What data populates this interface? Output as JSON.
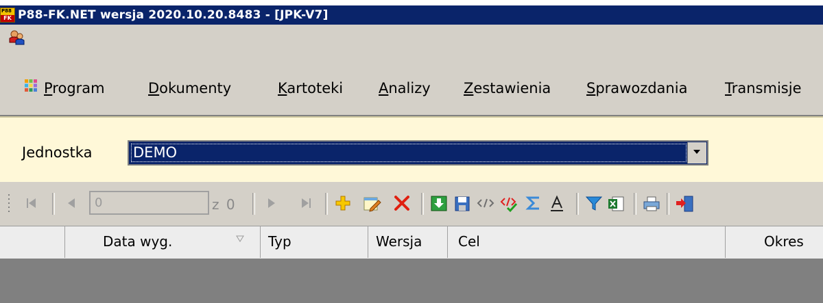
{
  "window": {
    "title": "P88-FK.NET wersja 2020.10.20.8483 - [JPK-V7]",
    "app_icon_top": "P88",
    "app_icon_bottom": "FK"
  },
  "menu": {
    "items": [
      {
        "pre": "",
        "key": "P",
        "post": "rogram"
      },
      {
        "pre": "",
        "key": "D",
        "post": "okumenty"
      },
      {
        "pre": "",
        "key": "K",
        "post": "artoteki"
      },
      {
        "pre": "",
        "key": "A",
        "post": "nalizy"
      },
      {
        "pre": "",
        "key": "Z",
        "post": "estawienia"
      },
      {
        "pre": "",
        "key": "S",
        "post": "prawozdania"
      },
      {
        "pre": "",
        "key": "T",
        "post": "ransmisje"
      }
    ]
  },
  "filter": {
    "label": "Jednostka",
    "value": "DEMO"
  },
  "navigator": {
    "position": "0",
    "count": "z 0"
  },
  "grid": {
    "columns": [
      "Data wyg.",
      "Typ",
      "Wersja",
      "Cel",
      "Okres"
    ]
  },
  "colors": {
    "titlebar": "#0a246a",
    "menubar": "#d4d0c8",
    "filterbar": "#fff8d8",
    "grid_empty": "#808080"
  }
}
